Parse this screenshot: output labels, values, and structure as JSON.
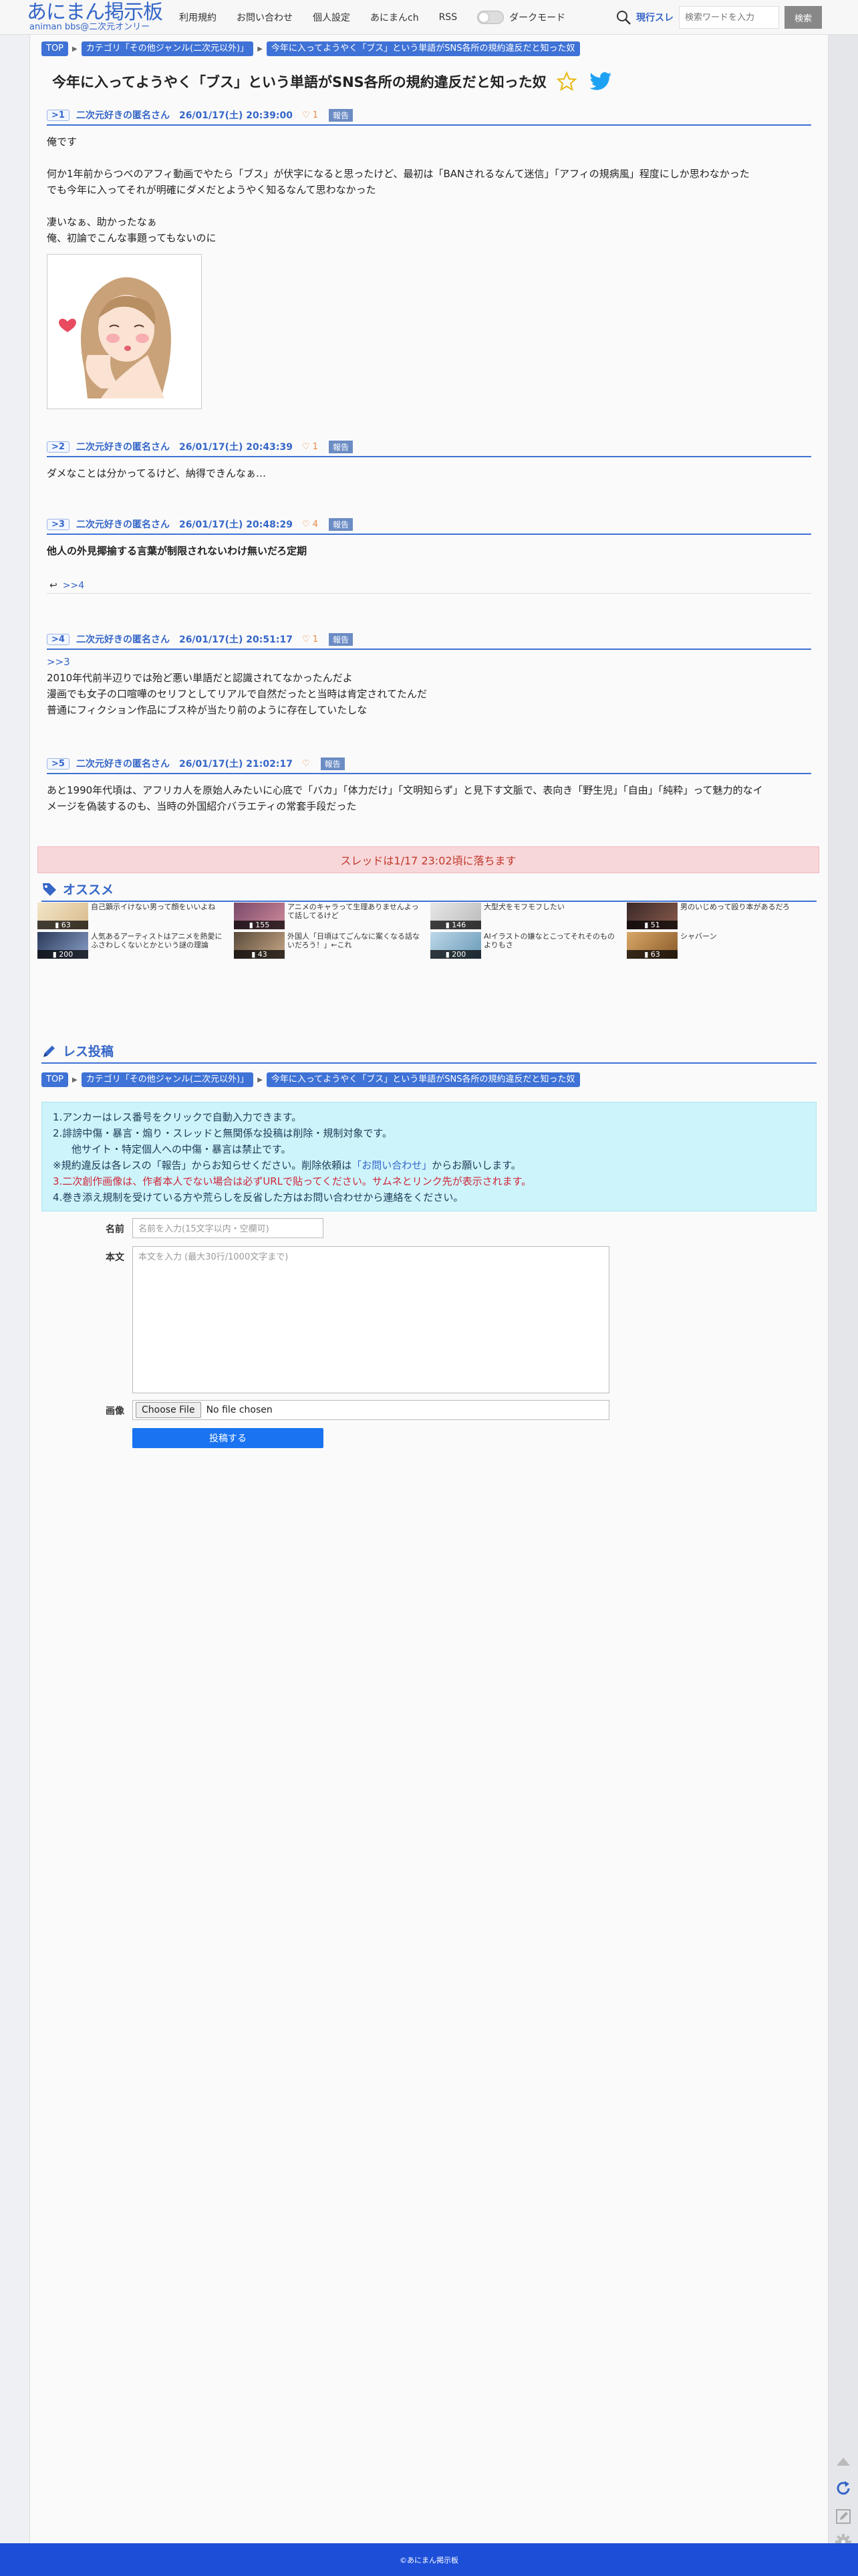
{
  "header": {
    "logo_main": "あにまん掲示板",
    "logo_sub": "animan bbs@二次元オンリー",
    "nav": [
      "利用規約",
      "お問い合わせ",
      "個人設定",
      "あにまんch",
      "RSS"
    ],
    "dark_mode_label": "ダークモード",
    "search_kind": "現行スレ",
    "search_placeholder": "検索ワードを入力",
    "search_button": "検索"
  },
  "breadcrumb": {
    "top": "TOP",
    "category": "カテゴリ「その他ジャンル(二次元以外)」",
    "thread": "今年に入ってようやく「ブス」という単語がSNS各所の規約違反だと知った奴"
  },
  "thread_title": "今年に入ってようやく「ブス」という単語がSNS各所の規約違反だと知った奴",
  "posts": [
    {
      "num": "1",
      "name": "二次元好きの匿名さん",
      "date": "26/01/17(土) 20:39:00",
      "likes": "1",
      "report": "報告",
      "lines": [
        "俺です",
        "",
        "何か1年前からつべのアフィ動画でやたら「ブス」が伏字になると思ったけど、最初は「BANされるなんて迷信」「アフィの規病風」程度にしか思わなかった",
        "でも今年に入ってそれが明確にダメだとようやく知るなんて思わなかった",
        "",
        "凄いなぁ、助かったなぁ",
        "俺、初論でこんな事題ってもないのに"
      ]
    },
    {
      "num": "2",
      "name": "二次元好きの匿名さん",
      "date": "26/01/17(土) 20:43:39",
      "likes": "1",
      "report": "報告",
      "lines": [
        "ダメなことは分かってるけど、納得できんなぁ…"
      ]
    },
    {
      "num": "3",
      "name": "二次元好きの匿名さん",
      "date": "26/01/17(土) 20:48:29",
      "likes": "4",
      "report": "報告",
      "lines": [
        "他人の外見揶揄する言葉が制限されないわけ無いだろ定期"
      ],
      "reply": ">>4"
    },
    {
      "num": "4",
      "name": "二次元好きの匿名さん",
      "date": "26/01/17(土) 20:51:17",
      "likes": "1",
      "report": "報告",
      "anchor": ">>3",
      "lines": [
        "2010年代前半辺りでは殆ど悪い単語だと認識されてなかったんだよ",
        "漫画でも女子の口喧嘩のセリフとしてリアルで自然だったと当時は肯定されてたんだ",
        "普通にフィクション作品にブス枠が当たり前のように存在していたしな"
      ]
    },
    {
      "num": "5",
      "name": "二次元好きの匿名さん",
      "date": "26/01/17(土) 21:02:17",
      "likes": "",
      "report": "報告",
      "lines": [
        "あと1990年代頃は、アフリカ人を原始人みたいに心底で「バカ」「体力だけ」「文明知らず」と見下す文脈で、表向き「野生児」「自由」「純粋」って魅力的なイ",
        "メージを偽装するのも、当時の外国紹介バラエティの常套手段だった"
      ]
    }
  ],
  "expire_notice": "スレッドは1/17 23:02頃に落ちます",
  "recommend": {
    "heading": "オススメ",
    "items": [
      {
        "count": "63",
        "text": "自己顕示イけない男って顔をいいよね"
      },
      {
        "count": "155",
        "text": "アニメのキャラって生理ありませんよって話してるけど"
      },
      {
        "count": "146",
        "text": "大型犬をモフモフしたい"
      },
      {
        "count": "51",
        "text": "男のいじめって殴り本があるだろ"
      },
      {
        "count": "200",
        "text": "人気あるアーティストはアニメを熱愛にふさわしくないとかという謎の理論"
      },
      {
        "count": "43",
        "text": "外国人「日頃はてごんなに案くなる話ないだろう！」←これ"
      },
      {
        "count": "200",
        "text": "AIイラストの嫌なとこってそれそのものよりもさ"
      },
      {
        "count": "63",
        "text": "シャバーン"
      }
    ]
  },
  "post_form": {
    "heading": "レス投稿",
    "notice": [
      "1.アンカーはレス番号をクリックで自動入力できます。",
      "2.誹謗中傷・暴言・煽り・スレッドと無関係な投稿は削除・規制対象です。",
      "他サイト・特定個人への中傷・暴言は禁止です。",
      "※規約違反は各レスの「報告」からお知らせください。削除依頼は",
      "「お問い合わせ」",
      "からお願いします。",
      "3.二次創作画像は、作者本人でない場合は必ずURLで貼ってください。サムネとリンク先が表示されます。",
      "4.巻き添え規制を受けている方や荒らしを反省した方はお問い合わせから連絡をください。"
    ],
    "name_label": "名前",
    "name_placeholder": "名前を入力(15文字以内・空欄可)",
    "body_label": "本文",
    "body_placeholder": "本文を入力 (最大30行/1000文字まで)",
    "image_label": "画像",
    "file_button": "Choose File",
    "file_status": "No file chosen",
    "submit": "投稿する"
  },
  "footer": "©あにまん掲示板",
  "colors": {
    "accent": "#3f72d6",
    "footer": "#1c4ed8",
    "submit": "#1a73f0",
    "expire_bg": "#f8d7da",
    "notice_bg": "#cdf4fb"
  }
}
